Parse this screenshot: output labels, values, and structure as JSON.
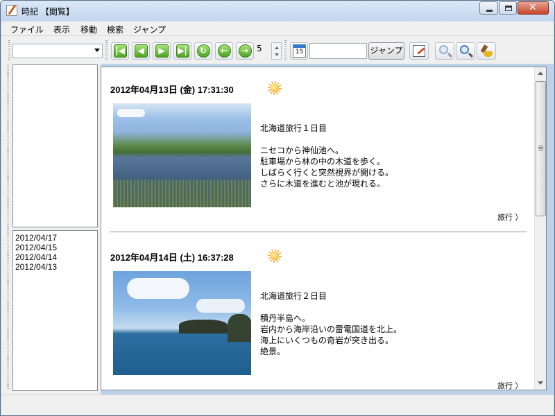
{
  "window": {
    "title": "時記 【閲覧】"
  },
  "menu": [
    "ファイル",
    "表示",
    "移動",
    "検索",
    "ジャンプ"
  ],
  "toolbar": {
    "combo_value": "",
    "nav_buttons": [
      "first-icon",
      "prev-page-icon",
      "next-page-icon",
      "last-icon",
      "refresh-icon",
      "back-icon",
      "forward-icon"
    ],
    "page_value": "5",
    "calendar_label": "15",
    "jump_value": "",
    "jump_label": "ジャンプ"
  },
  "sidebar": {
    "dates": [
      "2012/04/17",
      "2012/04/15",
      "2012/04/14",
      "2012/04/13"
    ]
  },
  "entries": [
    {
      "date": "2012年04月13日 (金) 17:31:30",
      "weather": "sun-icon",
      "text": "北海道旅行１日目\n\nニセコから神仙池へ。\n駐車場から林の中の木道を歩く。\nしばらく行くと突然視界が開ける。\nさらに木道を進むと池が現れる。",
      "tag": "旅行 ）"
    },
    {
      "date": "2012年04月14日 (土) 16:37:28",
      "weather": "sun-icon",
      "text": "北海道旅行２日目\n\n積丹半島へ。\n岩内から海岸沿いの雷電国道を北上。\n海上にいくつもの奇岩が突き出る。\n絶景。",
      "tag": "旅行 ）"
    }
  ]
}
